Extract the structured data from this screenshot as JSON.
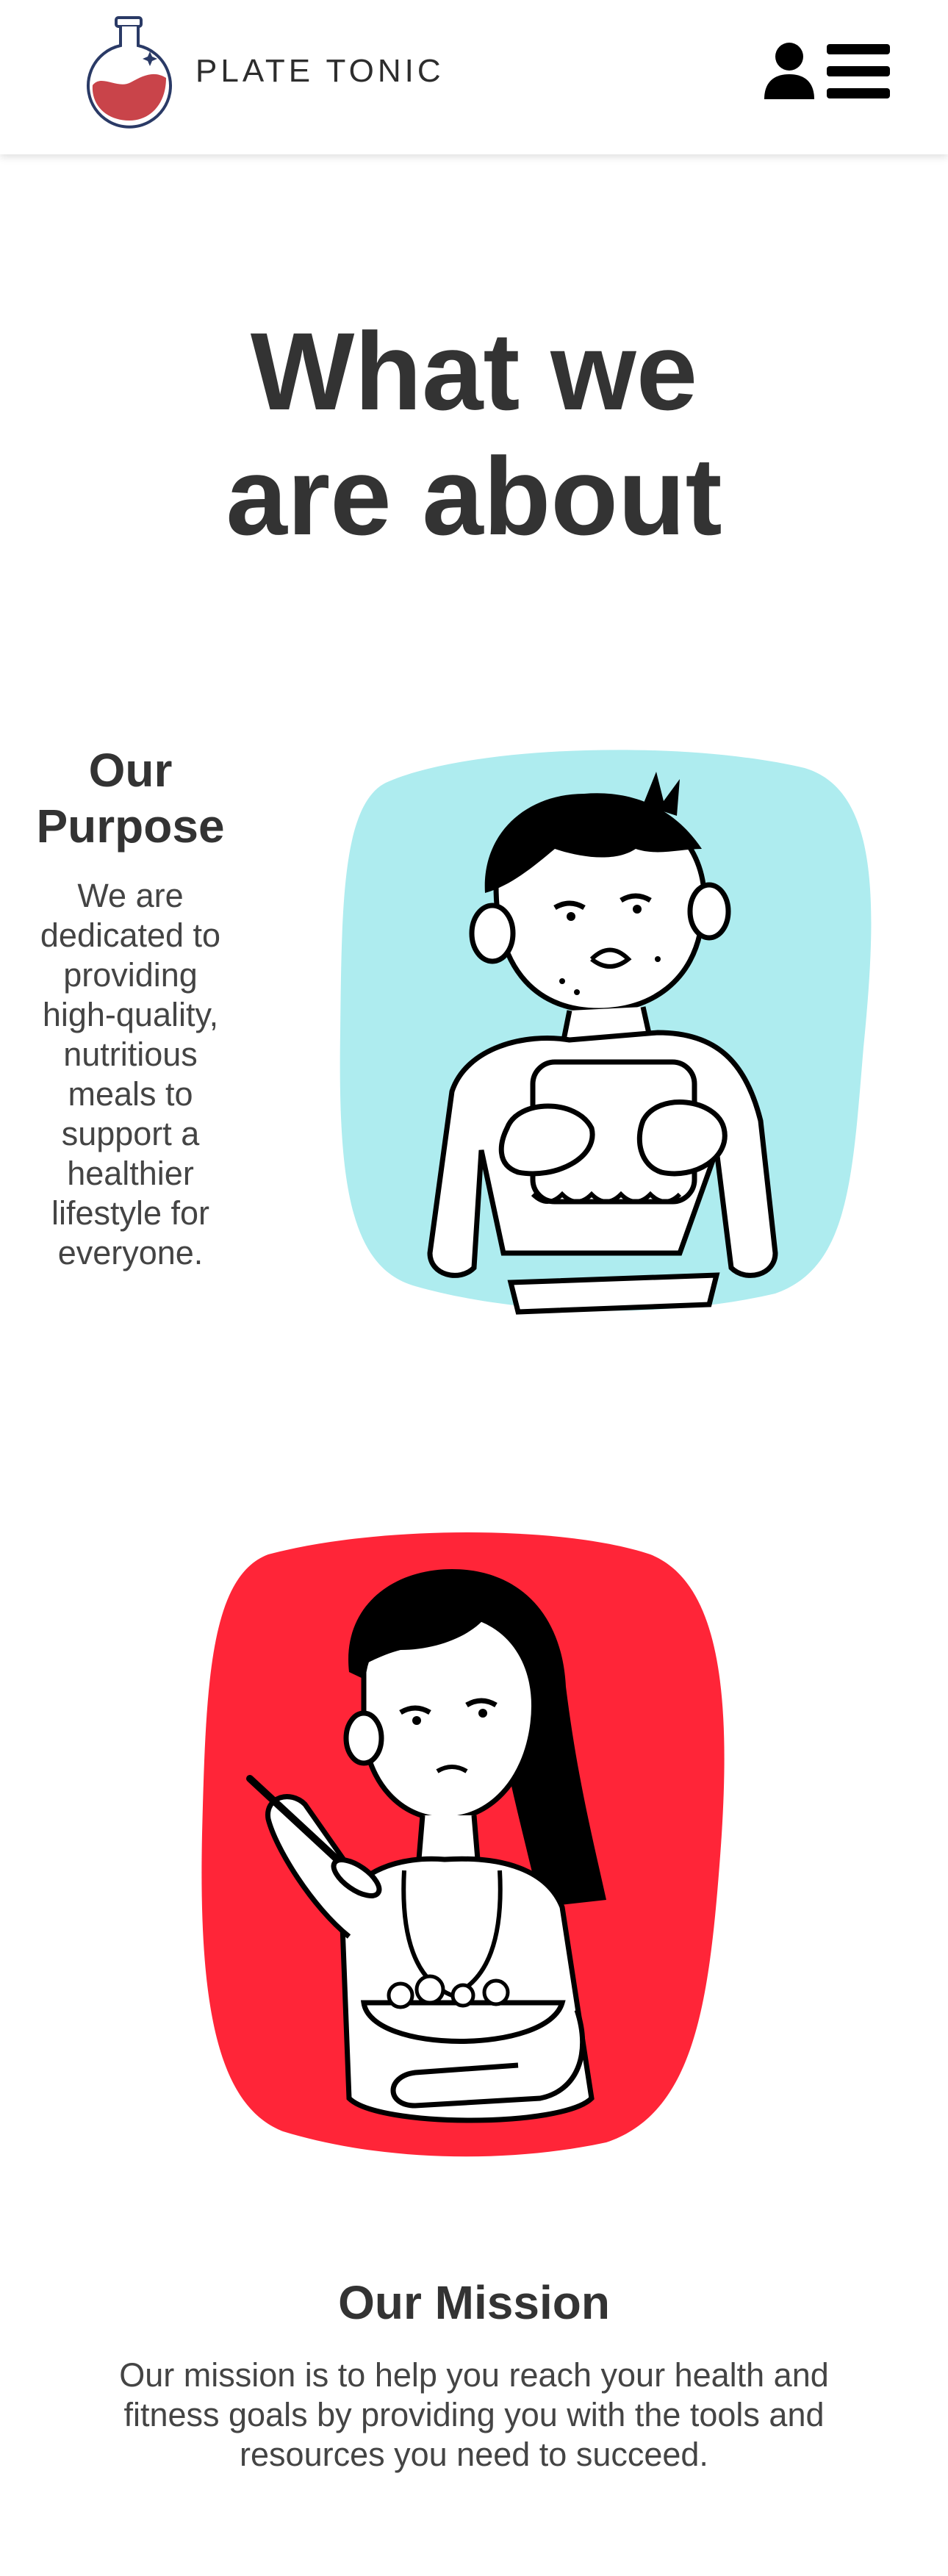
{
  "header": {
    "brand": "PLATE TONIC",
    "logo_icon": "flask-logo-icon",
    "user_icon": "user-icon",
    "menu_icon": "hamburger-menu-icon"
  },
  "hero": {
    "title_line1": "What we",
    "title_line2": "are about"
  },
  "purpose": {
    "heading": "Our Purpose",
    "text": "We are dedicated to providing high-quality, nutritious meals to support a healthier lifestyle for everyone.",
    "illustration_bg": "#aeecef"
  },
  "mission": {
    "heading": "Our Mission",
    "text": "Our mission is to help you reach your health and fitness goals by providing you with the tools and resources you need to succeed.",
    "illustration_bg": "#ff2538"
  },
  "colors": {
    "brand_red": "#c9444a",
    "brand_navy": "#2a3a66",
    "text": "#333333"
  }
}
